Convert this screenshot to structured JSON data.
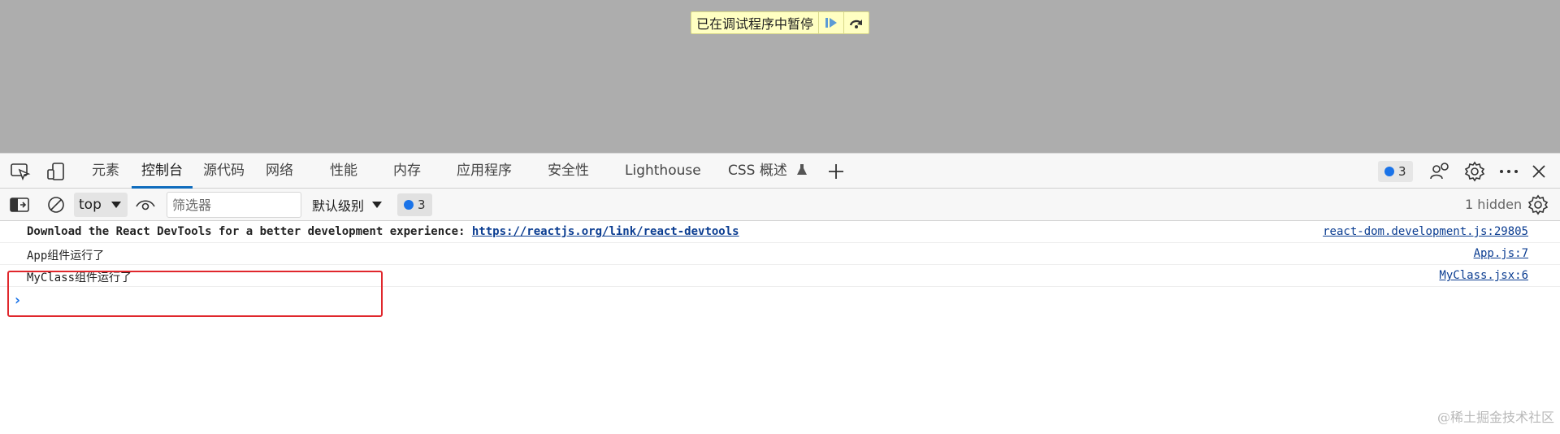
{
  "paused_banner": {
    "text": "已在调试程序中暂停",
    "resume_icon": "resume-icon",
    "step_over_icon": "step-over-icon"
  },
  "tabs": [
    "元素",
    "控制台",
    "源代码",
    "网络",
    "性能",
    "内存",
    "应用程序",
    "安全性",
    "Lighthouse",
    "CSS 概述"
  ],
  "active_tab": "控制台",
  "issues_badge": "3",
  "toolbar": {
    "context": "top",
    "filter_placeholder": "筛选器",
    "level": "默认级别",
    "messages_badge": "3",
    "hidden": "1 hidden"
  },
  "messages": [
    {
      "text": "Download the React DevTools for a better development experience: ",
      "link": "https://reactjs.org/link/react-devtools",
      "source": "react-dom.development.js:29805"
    },
    {
      "text": "App组件运行了",
      "source": "App.js:7"
    },
    {
      "text": "MyClass组件运行了",
      "source": "MyClass.jsx:6"
    }
  ],
  "prompt_symbol": "›",
  "watermark": "@稀土掘金技术社区",
  "colors": {
    "accent": "#0f6cbd",
    "highlight": "#e0272c",
    "paused_bg": "#ffffc2"
  }
}
